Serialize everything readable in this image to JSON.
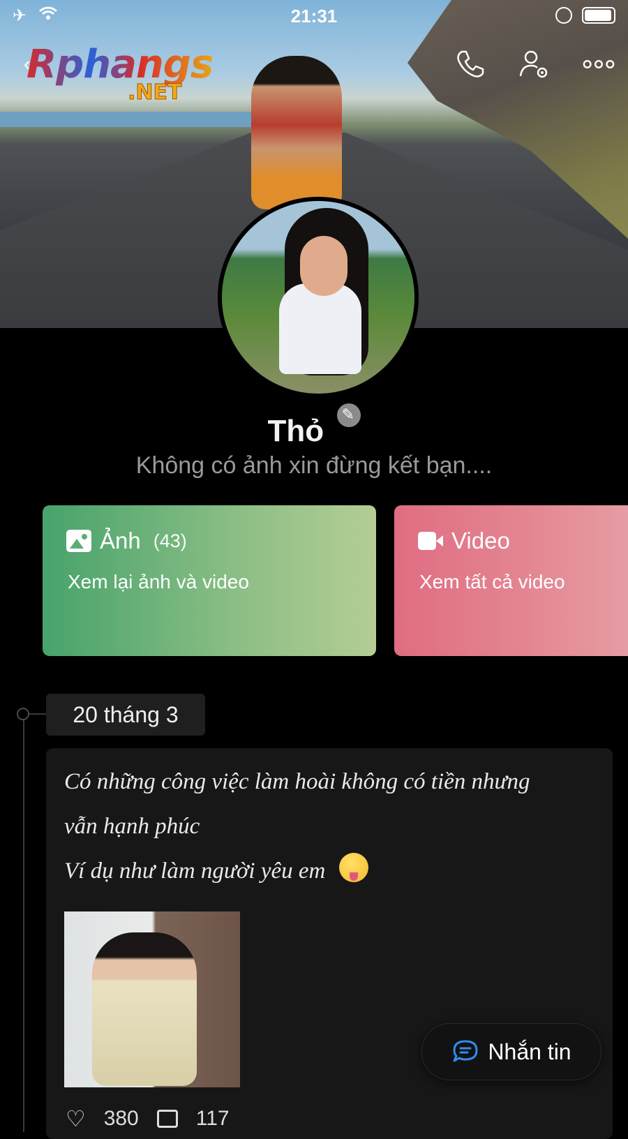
{
  "status_bar": {
    "time": "21:31"
  },
  "watermark": {
    "main": "Rphangs",
    "sub": ".NET"
  },
  "profile": {
    "name": "Thỏ",
    "bio": "Không có ảnh xin đừng kết bạn...."
  },
  "cards": {
    "photo": {
      "title": "Ảnh",
      "count": "(43)",
      "subtitle": "Xem lại ảnh và video"
    },
    "video": {
      "title": "Video",
      "subtitle": "Xem tất cả video"
    }
  },
  "timeline": {
    "date": "20 tháng 3",
    "post": {
      "line1": "Có những công việc làm hoài không có tiền nhưng",
      "line2": "vẫn hạnh phúc",
      "line3": "Ví dụ như làm người yêu em",
      "likes": "380",
      "comments": "117"
    }
  },
  "floating": {
    "message_label": "Nhắn tin"
  },
  "icons": [
    "airplane-icon",
    "wifi-icon",
    "rotation-lock-icon",
    "battery-icon",
    "back-icon",
    "phone-icon",
    "user-settings-icon",
    "more-icon",
    "edit-icon",
    "image-icon",
    "video-icon",
    "heart-icon",
    "comment-icon",
    "message-icon"
  ],
  "colors": {
    "photo_card_start": "#47a36b",
    "video_card_start": "#df6d82",
    "background": "#000000",
    "accent_blue": "#2f8cf0"
  }
}
